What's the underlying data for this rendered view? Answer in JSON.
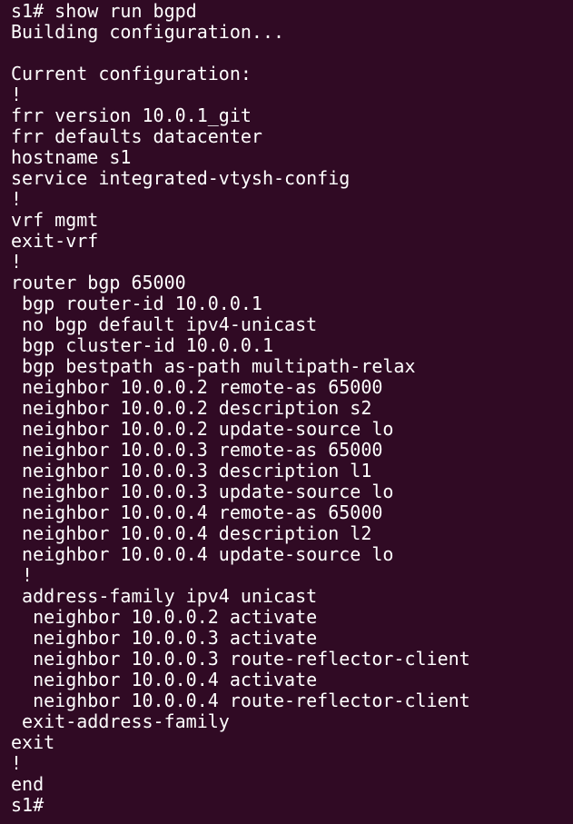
{
  "terminal": {
    "lines": [
      "s1# show run bgpd",
      "Building configuration...",
      "",
      "Current configuration:",
      "!",
      "frr version 10.0.1_git",
      "frr defaults datacenter",
      "hostname s1",
      "service integrated-vtysh-config",
      "!",
      "vrf mgmt",
      "exit-vrf",
      "!",
      "router bgp 65000",
      " bgp router-id 10.0.0.1",
      " no bgp default ipv4-unicast",
      " bgp cluster-id 10.0.0.1",
      " bgp bestpath as-path multipath-relax",
      " neighbor 10.0.0.2 remote-as 65000",
      " neighbor 10.0.0.2 description s2",
      " neighbor 10.0.0.2 update-source lo",
      " neighbor 10.0.0.3 remote-as 65000",
      " neighbor 10.0.0.3 description l1",
      " neighbor 10.0.0.3 update-source lo",
      " neighbor 10.0.0.4 remote-as 65000",
      " neighbor 10.0.0.4 description l2",
      " neighbor 10.0.0.4 update-source lo",
      " !",
      " address-family ipv4 unicast",
      "  neighbor 10.0.0.2 activate",
      "  neighbor 10.0.0.3 activate",
      "  neighbor 10.0.0.3 route-reflector-client",
      "  neighbor 10.0.0.4 activate",
      "  neighbor 10.0.0.4 route-reflector-client",
      " exit-address-family",
      "exit",
      "!",
      "end",
      "s1#"
    ],
    "colors": {
      "background": "#300a24",
      "foreground": "#ffffff"
    }
  }
}
